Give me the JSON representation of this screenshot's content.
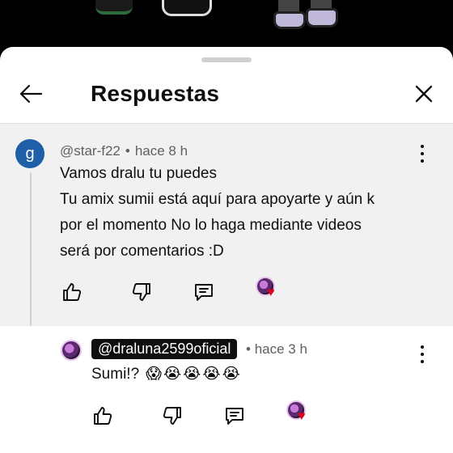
{
  "colors": {
    "accent_avatar": "#1e5fa8",
    "heart": "#e0001b",
    "text": "#0f0f0f",
    "meta": "#606060",
    "parent_bg": "#f1f1f1"
  },
  "header": {
    "title": "Respuestas",
    "back_icon": "arrow-left-icon",
    "close_icon": "close-icon"
  },
  "parent_comment": {
    "avatar_letter": "g",
    "author": "@star-f22",
    "separator": "•",
    "time": "hace 8 h",
    "lines": [
      "Vamos dralu tu puedes",
      "Tu amix sumii está aquí para apoyarte y aún k",
      "por el momento No lo haga mediante videos",
      "será por comentarios :D"
    ]
  },
  "reply": {
    "author": "@draluna2599oficial",
    "separator": "•",
    "time": "hace 3 h",
    "text": "Sumi!?",
    "emojis": [
      "😱",
      "😭",
      "😭",
      "😭",
      "😭"
    ]
  },
  "actions": {
    "like_icon": "thumbs-up-icon",
    "dislike_icon": "thumbs-down-icon",
    "reply_icon": "reply-icon",
    "creator_heart_icon": "creator-heart-icon"
  }
}
